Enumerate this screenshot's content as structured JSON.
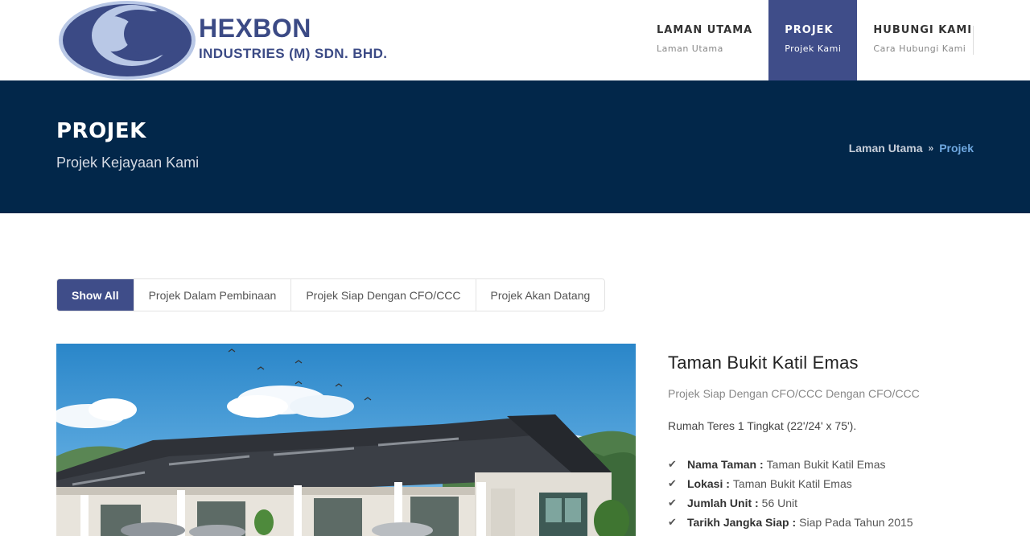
{
  "brand": {
    "name": "HEXBON",
    "subtitle": "INDUSTRIES (M) SDN. BHD.",
    "color": "#3b4a85"
  },
  "nav": {
    "items": [
      {
        "title": "LAMAN UTAMA",
        "sub": "Laman Utama",
        "active": false
      },
      {
        "title": "PROJEK",
        "sub": "Projek Kami",
        "active": true
      },
      {
        "title": "HUBUNGI KAMI",
        "sub": "Cara Hubungi Kami",
        "active": false
      }
    ],
    "active_color": "#3f4d89"
  },
  "page": {
    "title": "PROJEK",
    "subtitle": "Projek Kejayaan Kami",
    "band_color": "#02274a"
  },
  "breadcrumb": {
    "home": "Laman Utama",
    "separator": "»",
    "current": "Projek"
  },
  "filters": [
    {
      "label": "Show All",
      "active": true
    },
    {
      "label": "Projek Dalam Pembinaan",
      "active": false
    },
    {
      "label": "Projek Siap Dengan CFO/CCC",
      "active": false
    },
    {
      "label": "Projek Akan Datang",
      "active": false
    }
  ],
  "project": {
    "title": "Taman Bukit Katil Emas",
    "category": "Projek Siap Dengan CFO/CCC Dengan CFO/CCC",
    "description": "Rumah Teres 1 Tingkat (22'/24' x 75').",
    "facts": [
      {
        "label": "Nama Taman :",
        "value": "Taman Bukit Katil Emas"
      },
      {
        "label": "Lokasi :",
        "value": "Taman Bukit Katil Emas"
      },
      {
        "label": "Jumlah Unit :",
        "value": "56 Unit"
      },
      {
        "label": "Tarikh Jangka Siap :",
        "value": "Siap Pada Tahun 2015"
      }
    ],
    "fact_icon": "check-icon"
  }
}
